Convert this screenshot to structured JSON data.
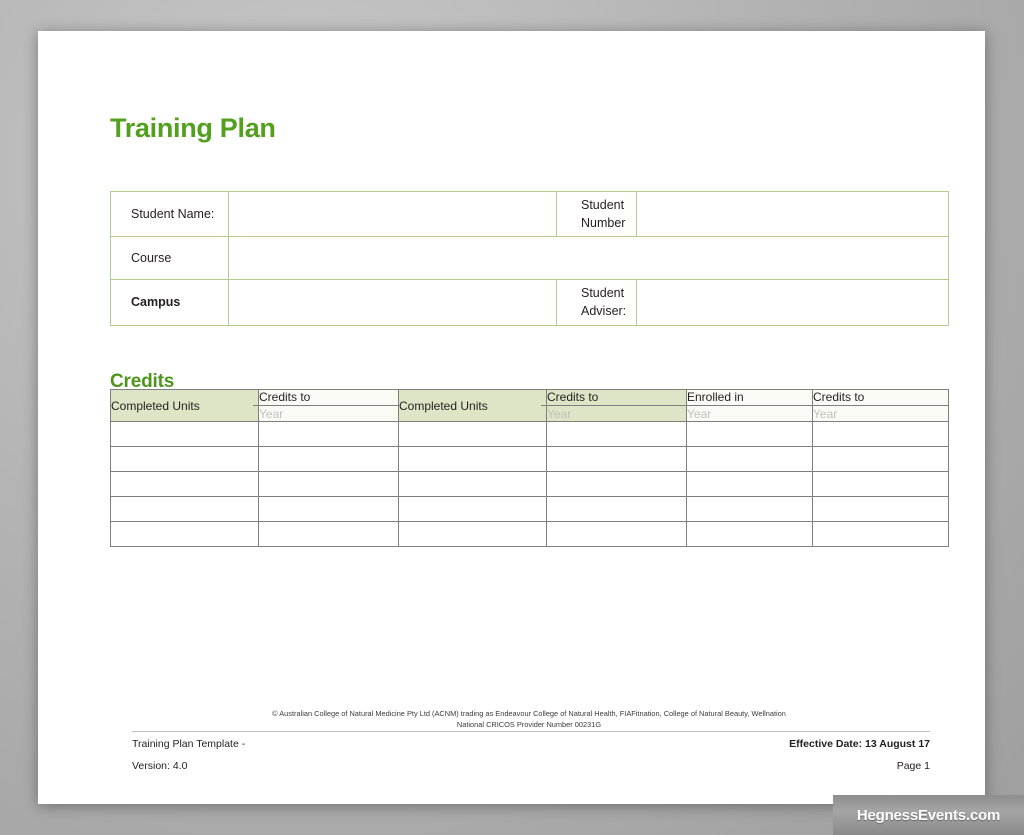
{
  "document": {
    "title": "Training Plan",
    "section_heading": "Credits"
  },
  "student_info": {
    "rows": [
      {
        "label_left": "Student Name:",
        "value_left": "",
        "label_right": "Student\nNumber",
        "value_right": ""
      },
      {
        "label_left": "Course",
        "value_left": ""
      },
      {
        "label_left": "Campus",
        "value_left": "",
        "label_right": "Student\nAdviser:",
        "value_right": ""
      }
    ],
    "labels": {
      "student_name": "Student Name:",
      "student_number_line1": "Student",
      "student_number_line2": "Number",
      "course": "Course",
      "campus": "Campus",
      "student_adviser_line1": "Student",
      "student_adviser_line2": "Adviser:"
    }
  },
  "credits_table": {
    "columns": [
      {
        "label": "Completed Units",
        "sublabel": "",
        "tinted": true
      },
      {
        "label": "Credits to",
        "sublabel": "Year",
        "tinted": false
      },
      {
        "label": "Completed Units",
        "sublabel": "",
        "tinted": true
      },
      {
        "label": "Credits to",
        "sublabel": "Year",
        "tinted": true
      },
      {
        "label": "Enrolled in",
        "sublabel": "Year",
        "tinted": false
      },
      {
        "label": "Credits to",
        "sublabel": "Year",
        "tinted": false
      }
    ],
    "row_count": 5,
    "rows": [
      [
        "",
        "",
        "",
        "",
        "",
        ""
      ],
      [
        "",
        "",
        "",
        "",
        "",
        ""
      ],
      [
        "",
        "",
        "",
        "",
        "",
        ""
      ],
      [
        "",
        "",
        "",
        "",
        "",
        ""
      ],
      [
        "",
        "",
        "",
        "",
        "",
        ""
      ]
    ]
  },
  "footer": {
    "copyright_line_1": "© Australian College of Natural Medicine Pty Ltd (ACNM) trading as Endeavour College of Natural Health, FIAFitnation, College of Natural Beauty, Wellnation",
    "copyright_line_2": "National CRICOS Provider Number 00231G",
    "template_name": "Training Plan Template -",
    "version": "Version: 4.0",
    "effective_date": "Effective Date: 13 August 17",
    "page_number": "Page 1"
  },
  "watermark": {
    "text": "HegnessEvents.com"
  },
  "colors": {
    "title_green": "#52a01e",
    "heading_green": "#4f951d",
    "table_border_green": "#b3cc8c",
    "header_tint": "#dde5c6",
    "grid_gray": "#7f7f7f"
  }
}
